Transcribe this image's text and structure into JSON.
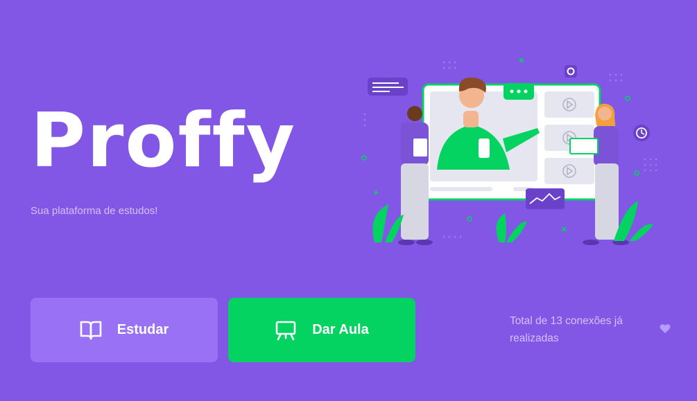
{
  "brand": {
    "logo_text": "Proffy",
    "tagline": "Sua plataforma de estudos!"
  },
  "actions": {
    "study_label": "Estudar",
    "teach_label": "Dar Aula"
  },
  "footer": {
    "total_connections": "Total de 13 conexões já realizadas"
  },
  "icons": {
    "study": "book-open-icon",
    "teach": "presentation-board-icon",
    "heart": "heart-icon"
  },
  "colors": {
    "background": "#8257e5",
    "study_button": "#9871f5",
    "teach_button": "#04d361",
    "text_light": "#d4c2ff"
  }
}
